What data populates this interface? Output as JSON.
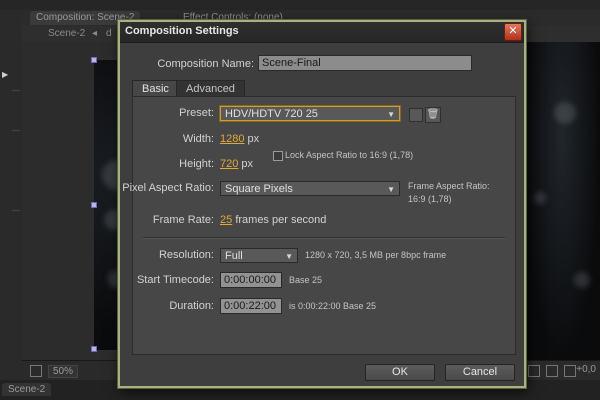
{
  "background": {
    "panel_tab_active": "Composition: Scene-2",
    "panel_tab_other": "Effect Controls: (none)",
    "breadcrumb_scene": "Scene-2",
    "breadcrumb_next": "d",
    "zoom": "50%",
    "footer_value": "+0,0",
    "timeline_tab": "Scene-2"
  },
  "dialog": {
    "title": "Composition Settings",
    "close_glyph": "✕",
    "composition_name_label": "Composition Name:",
    "composition_name_value": "Scene-Final",
    "tabs": [
      "Basic",
      "Advanced"
    ],
    "preset_label": "Preset:",
    "preset_value": "HDV/HDTV 720 25",
    "width_label": "Width:",
    "width_value": "1280",
    "width_unit": "px",
    "height_label": "Height:",
    "height_value": "720",
    "height_unit": "px",
    "lock_aspect_label": "Lock Aspect Ratio to 16:9 (1,78)",
    "pixel_aspect_label": "Pixel Aspect Ratio:",
    "pixel_aspect_value": "Square Pixels",
    "frame_aspect_label": "Frame Aspect Ratio:",
    "frame_aspect_value": "16:9 (1,78)",
    "frame_rate_label": "Frame Rate:",
    "frame_rate_value": "25",
    "frame_rate_unit": "frames per second",
    "resolution_label": "Resolution:",
    "resolution_value": "Full",
    "resolution_info": "1280 x 720, 3,5 MB per 8bpc frame",
    "start_timecode_label": "Start Timecode:",
    "start_timecode_value": "0:00:00:00",
    "start_timecode_base": "Base 25",
    "duration_label": "Duration:",
    "duration_value": "0:00:22:00",
    "duration_info": "is 0:00:22:00  Base 25",
    "ok_label": "OK",
    "cancel_label": "Cancel"
  },
  "colors": {
    "dialog_border": "#a6b37f",
    "link_value": "#e0a93e",
    "focus_ring": "#d19b35",
    "close_button": "#c5432a"
  },
  "icons": {
    "preset_save": "save-preset-icon",
    "preset_delete": "trash-icon",
    "dropdown": "caret-down-icon"
  }
}
